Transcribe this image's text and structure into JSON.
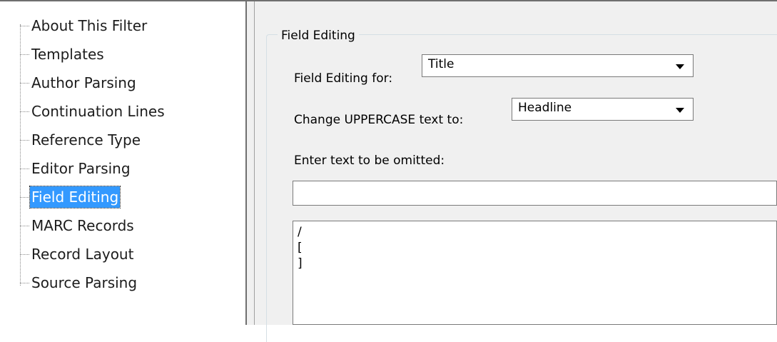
{
  "tree": {
    "items": [
      {
        "label": "About This Filter"
      },
      {
        "label": "Templates"
      },
      {
        "label": "Author Parsing"
      },
      {
        "label": "Continuation Lines"
      },
      {
        "label": "Reference Type"
      },
      {
        "label": "Editor Parsing"
      },
      {
        "label": "Field Editing",
        "selected": true
      },
      {
        "label": "MARC Records"
      },
      {
        "label": "Record Layout"
      },
      {
        "label": "Source Parsing"
      }
    ]
  },
  "panel": {
    "group_title": "Field Editing",
    "field_editing_for_label": "Field Editing for:",
    "field_editing_for_value": "Title",
    "uppercase_label": "Change UPPERCASE text to:",
    "uppercase_value": "Headline",
    "omit_label": "Enter text to be omitted:",
    "omit_input_value": "",
    "omit_list": [
      "/",
      "[",
      "]"
    ]
  },
  "colors": {
    "selection": "#3399ff",
    "panel_background": "#f0f0f0"
  }
}
